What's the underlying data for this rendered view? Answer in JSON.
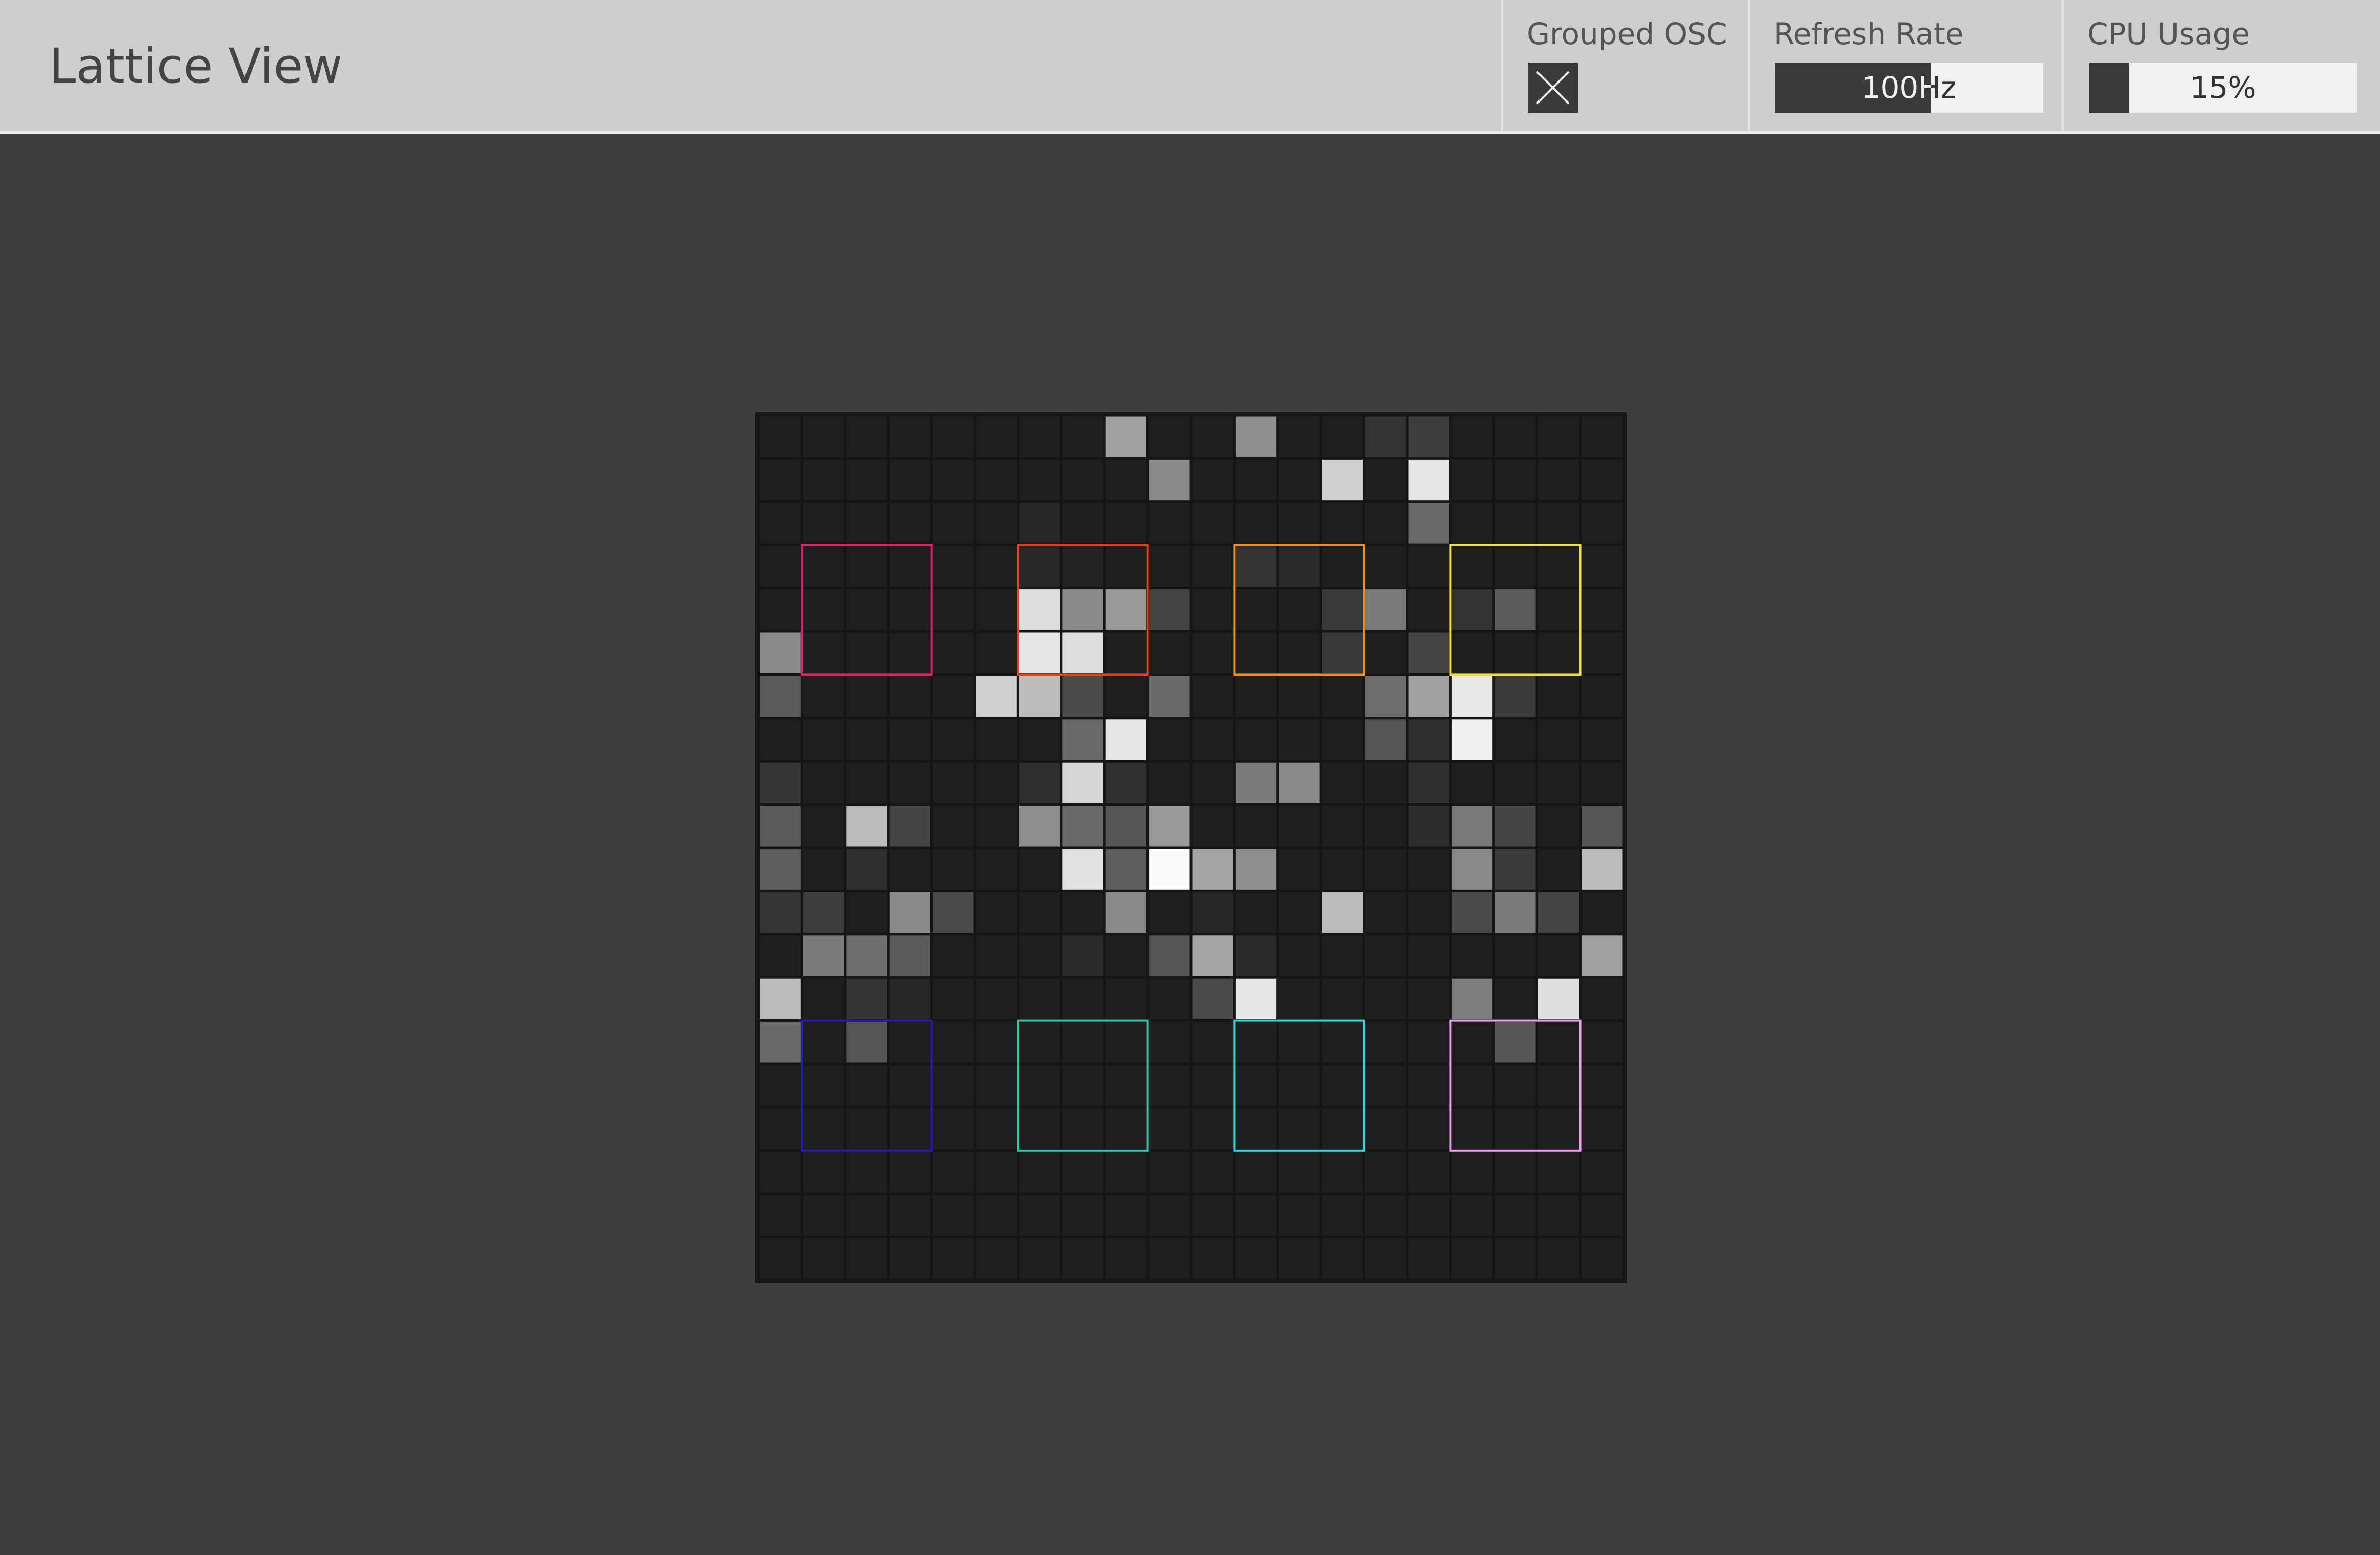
{
  "app": {
    "title": "Lattice View"
  },
  "controls": {
    "grouped_osc": {
      "label": "Grouped OSC",
      "checked": true,
      "icon": "x-icon"
    },
    "refresh_rate": {
      "label": "Refresh Rate",
      "value_text": "100Hz",
      "fill_fraction": 0.58
    },
    "cpu_usage": {
      "label": "CPU Usage",
      "value_text": "15%",
      "fill_fraction": 0.15
    }
  },
  "lattice": {
    "rows": 20,
    "cols": 20,
    "empty_cell_color": "#1e1e1e",
    "grid_line_color": "#151515",
    "cells": [
      [
        0,
        8,
        "#a0a0a0"
      ],
      [
        0,
        11,
        "#8e8e8e"
      ],
      [
        0,
        14,
        "#333333"
      ],
      [
        0,
        15,
        "#3e3e3e"
      ],
      [
        1,
        9,
        "#8a8a8a"
      ],
      [
        1,
        13,
        "#cfcfcf"
      ],
      [
        1,
        15,
        "#e6e6e6"
      ],
      [
        2,
        6,
        "#262626"
      ],
      [
        2,
        15,
        "#6a6a6a"
      ],
      [
        3,
        6,
        "#282828"
      ],
      [
        3,
        7,
        "#232323"
      ],
      [
        3,
        11,
        "#333333"
      ],
      [
        3,
        12,
        "#2a2a2a"
      ],
      [
        4,
        6,
        "#dedede"
      ],
      [
        4,
        7,
        "#8a8a8a"
      ],
      [
        4,
        8,
        "#9a9a9a"
      ],
      [
        4,
        9,
        "#444444"
      ],
      [
        4,
        13,
        "#3a3a3a"
      ],
      [
        4,
        14,
        "#7a7a7a"
      ],
      [
        4,
        16,
        "#333333"
      ],
      [
        4,
        17,
        "#5a5a5a"
      ],
      [
        5,
        0,
        "#8a8a8a"
      ],
      [
        5,
        6,
        "#e6e6e6"
      ],
      [
        5,
        7,
        "#dedede"
      ],
      [
        5,
        13,
        "#383838"
      ],
      [
        5,
        15,
        "#444444"
      ],
      [
        6,
        0,
        "#5a5a5a"
      ],
      [
        6,
        5,
        "#cfcfcf"
      ],
      [
        6,
        6,
        "#bcbcbc"
      ],
      [
        6,
        7,
        "#4a4a4a"
      ],
      [
        6,
        9,
        "#6a6a6a"
      ],
      [
        6,
        14,
        "#6e6e6e"
      ],
      [
        6,
        15,
        "#a0a0a0"
      ],
      [
        6,
        16,
        "#e8e8e8"
      ],
      [
        6,
        17,
        "#3a3a3a"
      ],
      [
        7,
        7,
        "#6a6a6a"
      ],
      [
        7,
        8,
        "#e6e6e6"
      ],
      [
        7,
        14,
        "#555555"
      ],
      [
        7,
        15,
        "#2e2e2e"
      ],
      [
        7,
        16,
        "#f0f0f0"
      ],
      [
        8,
        0,
        "#363636"
      ],
      [
        8,
        6,
        "#2e2e2e"
      ],
      [
        8,
        7,
        "#d6d6d6"
      ],
      [
        8,
        8,
        "#303030"
      ],
      [
        8,
        11,
        "#7a7a7a"
      ],
      [
        8,
        12,
        "#8a8a8a"
      ],
      [
        8,
        15,
        "#2e2e2e"
      ],
      [
        9,
        0,
        "#5a5a5a"
      ],
      [
        9,
        2,
        "#bcbcbc"
      ],
      [
        9,
        3,
        "#444444"
      ],
      [
        9,
        6,
        "#8e8e8e"
      ],
      [
        9,
        7,
        "#6a6a6a"
      ],
      [
        9,
        8,
        "#555555"
      ],
      [
        9,
        9,
        "#9a9a9a"
      ],
      [
        9,
        15,
        "#2c2c2c"
      ],
      [
        9,
        16,
        "#7a7a7a"
      ],
      [
        9,
        17,
        "#444444"
      ],
      [
        9,
        19,
        "#555555"
      ],
      [
        10,
        0,
        "#5e5e5e"
      ],
      [
        10,
        2,
        "#2e2e2e"
      ],
      [
        10,
        7,
        "#e2e2e2"
      ],
      [
        10,
        8,
        "#5e5e5e"
      ],
      [
        10,
        9,
        "#fafafa"
      ],
      [
        10,
        10,
        "#a6a6a6"
      ],
      [
        10,
        11,
        "#8e8e8e"
      ],
      [
        10,
        16,
        "#8a8a8a"
      ],
      [
        10,
        17,
        "#3a3a3a"
      ],
      [
        10,
        19,
        "#bcbcbc"
      ],
      [
        11,
        0,
        "#363636"
      ],
      [
        11,
        1,
        "#3e3e3e"
      ],
      [
        11,
        3,
        "#8a8a8a"
      ],
      [
        11,
        4,
        "#4a4a4a"
      ],
      [
        11,
        8,
        "#8a8a8a"
      ],
      [
        11,
        10,
        "#262626"
      ],
      [
        11,
        13,
        "#bcbcbc"
      ],
      [
        11,
        16,
        "#4a4a4a"
      ],
      [
        11,
        17,
        "#7a7a7a"
      ],
      [
        11,
        18,
        "#444444"
      ],
      [
        12,
        1,
        "#7a7a7a"
      ],
      [
        12,
        2,
        "#6e6e6e"
      ],
      [
        12,
        3,
        "#5a5a5a"
      ],
      [
        12,
        7,
        "#2a2a2a"
      ],
      [
        12,
        9,
        "#555555"
      ],
      [
        12,
        10,
        "#a6a6a6"
      ],
      [
        12,
        11,
        "#2a2a2a"
      ],
      [
        12,
        19,
        "#a0a0a0"
      ],
      [
        13,
        0,
        "#bcbcbc"
      ],
      [
        13,
        2,
        "#333333"
      ],
      [
        13,
        3,
        "#262626"
      ],
      [
        13,
        10,
        "#4a4a4a"
      ],
      [
        13,
        11,
        "#e6e6e6"
      ],
      [
        13,
        16,
        "#7e7e7e"
      ],
      [
        13,
        18,
        "#dedede"
      ],
      [
        14,
        0,
        "#6a6a6a"
      ],
      [
        14,
        2,
        "#555555"
      ],
      [
        14,
        17,
        "#555555"
      ]
    ],
    "markers": [
      {
        "id": "slot-1",
        "row": 3,
        "col": 1,
        "color": "#e0206a"
      },
      {
        "id": "slot-2",
        "row": 3,
        "col": 6,
        "color": "#e8401a"
      },
      {
        "id": "slot-3",
        "row": 3,
        "col": 11,
        "color": "#f0901a"
      },
      {
        "id": "slot-4",
        "row": 3,
        "col": 16,
        "color": "#f2e030"
      },
      {
        "id": "slot-5",
        "row": 14,
        "col": 1,
        "color": "#2a1ab8"
      },
      {
        "id": "slot-6",
        "row": 14,
        "col": 6,
        "color": "#30c8b0"
      },
      {
        "id": "slot-7",
        "row": 14,
        "col": 11,
        "color": "#38d8e0"
      },
      {
        "id": "slot-8",
        "row": 14,
        "col": 16,
        "color": "#f0a0f0"
      }
    ],
    "marker_size_cells": 3
  }
}
